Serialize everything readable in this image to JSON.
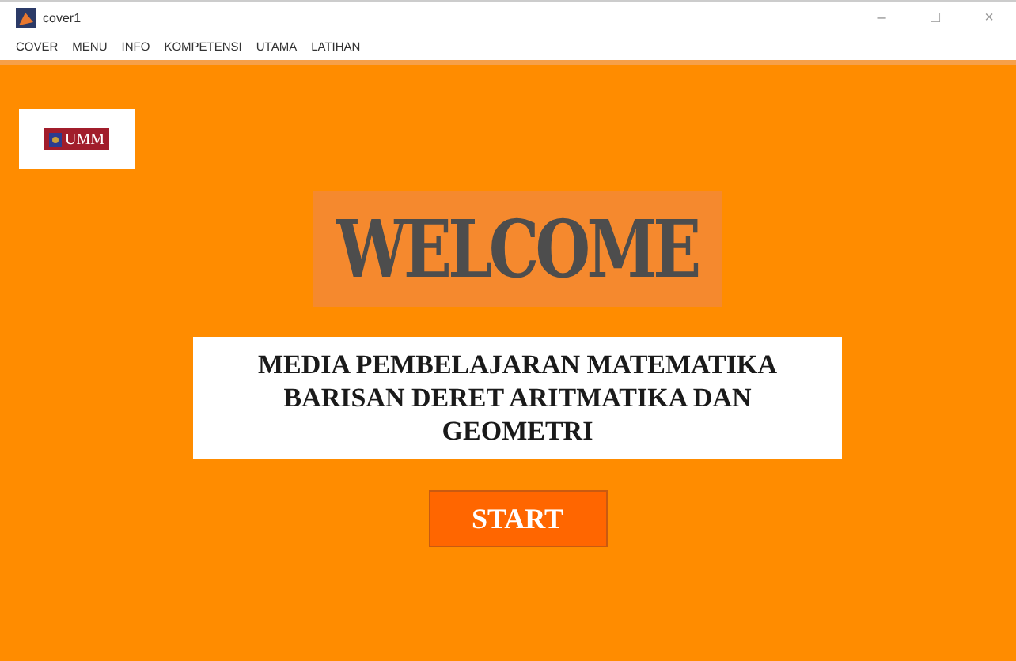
{
  "window": {
    "title": "cover1",
    "controls": [
      "–",
      "□",
      "×"
    ]
  },
  "menu": [
    "COVER",
    "MENU",
    "INFO",
    "KOMPETENSI",
    "UTAMA",
    "LATIHAN"
  ],
  "logo": {
    "text": "UMM"
  },
  "welcome": "WELCOME",
  "subtitle": [
    "MEDIA PEMBELAJARAN MATEMATIKA",
    "BARISAN DERET ARITMATIKA DAN",
    "GEOMETRI"
  ],
  "start_button": "START"
}
